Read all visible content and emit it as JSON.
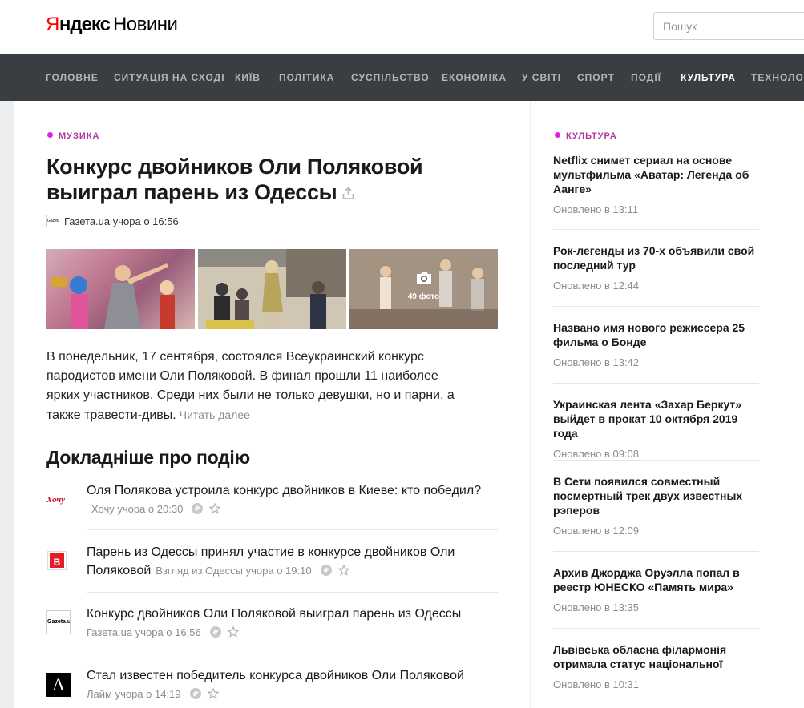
{
  "header": {
    "logo_ya": "Я",
    "logo_ndex": "ндекс",
    "logo_service": "Новини",
    "search_placeholder": "Пошук"
  },
  "nav": [
    {
      "label": "Головне",
      "active": false
    },
    {
      "label": "Ситуація на Сході",
      "active": false
    },
    {
      "label": "Київ",
      "active": false
    },
    {
      "label": "Політика",
      "active": false
    },
    {
      "label": "Суспільство",
      "active": false
    },
    {
      "label": "Економіка",
      "active": false
    },
    {
      "label": "У світі",
      "active": false
    },
    {
      "label": "Спорт",
      "active": false
    },
    {
      "label": "Події",
      "active": false
    },
    {
      "label": "Культура",
      "active": true
    },
    {
      "label": "Технології",
      "active": false
    }
  ],
  "article": {
    "rubric": "Музика",
    "title": "Конкурс двойников Оли Поляковой выиграл парень из Одессы",
    "source": "Газета.ua",
    "source_favicon": "Gazeta.ua",
    "time": "учора о 16:56",
    "photo_count": "49 фото",
    "annotation": "В понедельник, 17 сентября, состоялся Всеукраинский конкурс пародистов имени Оли Поляковой. В финал прошли 11 наиболее ярких участников. Среди них были не только девушки, но и парни, а также травести-дивы.",
    "read_more": "Читать далее"
  },
  "more": {
    "heading": "Докладніше про подію",
    "stories": [
      {
        "title": "Оля Полякова устроила конкурс двойников в Киеве: кто победил?",
        "meta": "Хочу учора о 20:30",
        "logo": "Хочу"
      },
      {
        "title": "Парень из Одессы принял участие в конкурсе двойников Оли Поляковой",
        "meta": "Взгляд из Одессы учора о 19:10",
        "logo": "В"
      },
      {
        "title": "Конкурс двойников Оли Поляковой выиграл парень из Одессы",
        "meta": "Газета.ua учора о 16:56",
        "logo": "Gazeta.ua"
      },
      {
        "title": "Стал известен победитель конкурса двойников Оли Поляковой",
        "meta": "Лайм учора о 14:19",
        "logo": "A"
      }
    ]
  },
  "sidebar": {
    "rubric": "Культура",
    "items": [
      {
        "title": "Netflix снимет сериал на основе мультфильма «Аватар: Легенда об Аанге»",
        "updated": "Оновлено в 13:11"
      },
      {
        "title": "Рок-легенды из 70-х объявили свой последний тур",
        "updated": "Оновлено в 12:44"
      },
      {
        "title": "Названо имя нового режиссера 25 фильма о Бонде",
        "updated": "Оновлено в 13:42"
      },
      {
        "title": "Украинская лента «Захар Беркут» выйдет в прокат 10 октября 2019 года",
        "updated": "Оновлено в 09:08"
      },
      {
        "title": "В Сети появился совместный посмертный трек двух известных рэперов",
        "updated": "Оновлено в 12:09"
      },
      {
        "title": "Архив Джорджа Оруэлла попал в реестр ЮНЕСКО «Память мира»",
        "updated": "Оновлено в 13:35"
      },
      {
        "title": "Львівська обласна філармонія отримала статус національної",
        "updated": "Оновлено в 10:31"
      }
    ]
  }
}
